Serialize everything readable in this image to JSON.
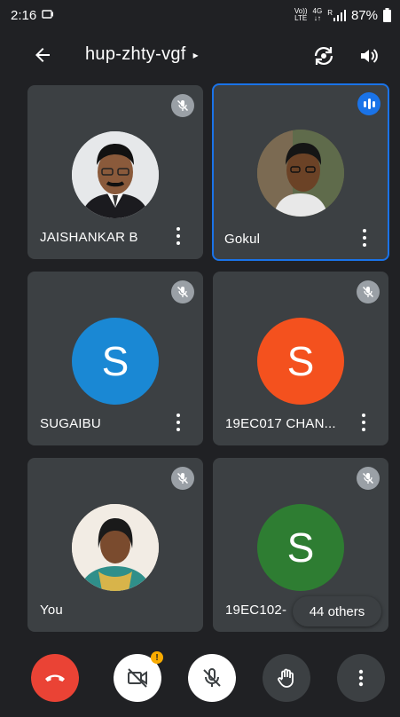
{
  "status_bar": {
    "time": "2:16",
    "volte_label_top": "Vo))",
    "volte_label_bottom": "LTE",
    "network_label": "4G",
    "signal_label": "R",
    "battery": "87%"
  },
  "header": {
    "meeting_code": "hup-zhty-vgf",
    "caret": "▸"
  },
  "participants": [
    {
      "name": "JAISHANKAR B",
      "initial": "",
      "avatar_color": "#c8ccd0",
      "muted": true,
      "speaking": false
    },
    {
      "name": "Gokul",
      "initial": "",
      "avatar_color": "#6d5b4a",
      "muted": false,
      "speaking": true
    },
    {
      "name": "SUGAIBU",
      "initial": "S",
      "avatar_color": "#1a88d4",
      "muted": true,
      "speaking": false
    },
    {
      "name": "19EC017 CHAN...",
      "initial": "S",
      "avatar_color": "#f4511e",
      "muted": true,
      "speaking": false
    },
    {
      "name": "You",
      "initial": "",
      "avatar_color": "#d9c7b0",
      "muted": true,
      "speaking": false
    },
    {
      "name": "19EC102-",
      "initial": "S",
      "avatar_color": "#2e7d32",
      "muted": true,
      "speaking": false
    }
  ],
  "others_chip": "44 others",
  "controls": {
    "end_call_color": "#ea4335",
    "camera_warning": "!"
  },
  "colors": {
    "background": "#202124",
    "tile": "#3c4043",
    "accent": "#1a73e8"
  }
}
